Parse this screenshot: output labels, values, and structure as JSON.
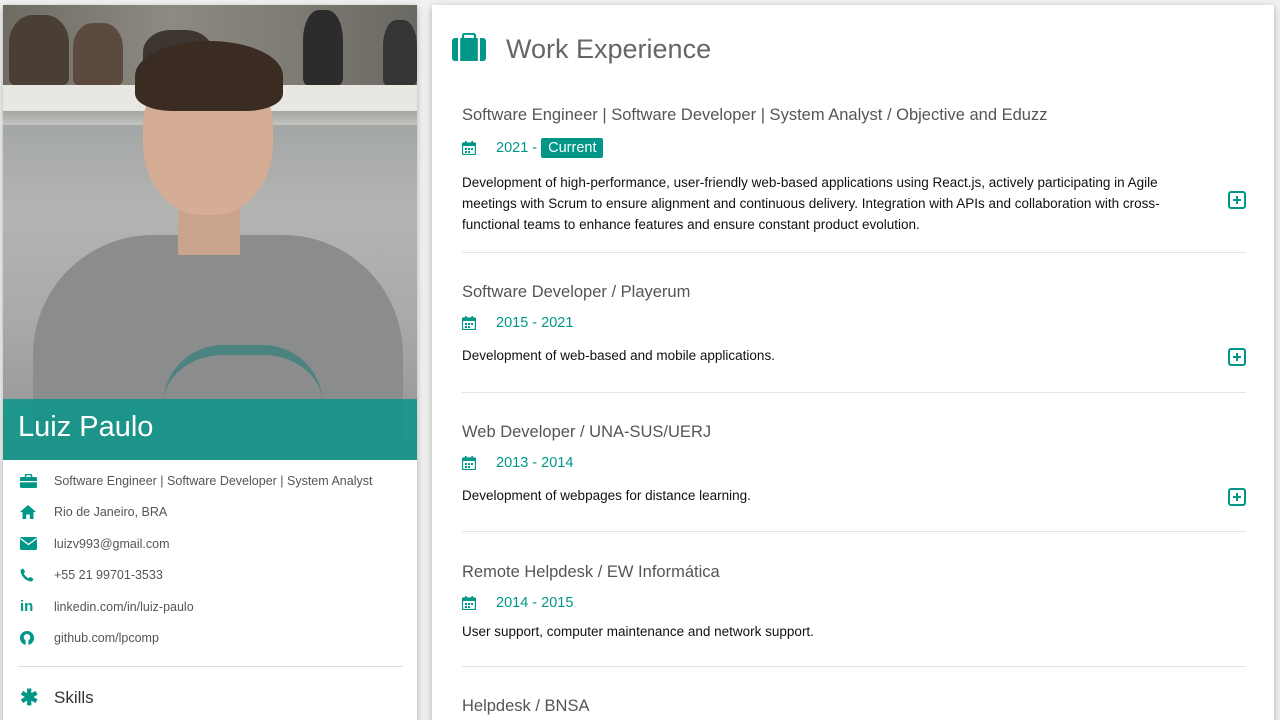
{
  "profile": {
    "name": "Luiz Paulo",
    "info": [
      {
        "icon": "briefcase-icon",
        "text": "Software Engineer | Software Developer | System Analyst"
      },
      {
        "icon": "home-icon",
        "text": "Rio de Janeiro, BRA"
      },
      {
        "icon": "envelope-icon",
        "text": "luizv993@gmail.com"
      },
      {
        "icon": "phone-icon",
        "text": "+55 21 99701-3533"
      },
      {
        "icon": "linkedin-icon",
        "text": "linkedin.com/in/luiz-paulo"
      },
      {
        "icon": "github-icon",
        "text": "github.com/lpcomp"
      }
    ],
    "skills_label": "Skills"
  },
  "work": {
    "title": "Work Experience",
    "jobs": [
      {
        "title": "Software Engineer | Software Developer | System Analyst / Objective and Eduzz",
        "period": "2021 -",
        "badge": "Current",
        "description": "Development of high-performance, user-friendly web-based applications using React.js, actively participating in Agile meetings with Scrum to ensure alignment and continuous delivery. Integration with APIs and collaboration with cross-functional teams to enhance features and ensure constant product evolution."
      },
      {
        "title": "Software Developer / Playerum",
        "period": "2015 - 2021",
        "description": "Development of web-based and mobile applications."
      },
      {
        "title": "Web Developer / UNA-SUS/UERJ",
        "period": "2013 - 2014",
        "description": "Development of webpages for distance learning."
      },
      {
        "title": "Remote Helpdesk / EW Informática",
        "period": "2014 - 2015",
        "description": "User support, computer maintenance and network support."
      },
      {
        "title": "Helpdesk / BNSA"
      }
    ]
  },
  "colors": {
    "accent": "#009688"
  }
}
